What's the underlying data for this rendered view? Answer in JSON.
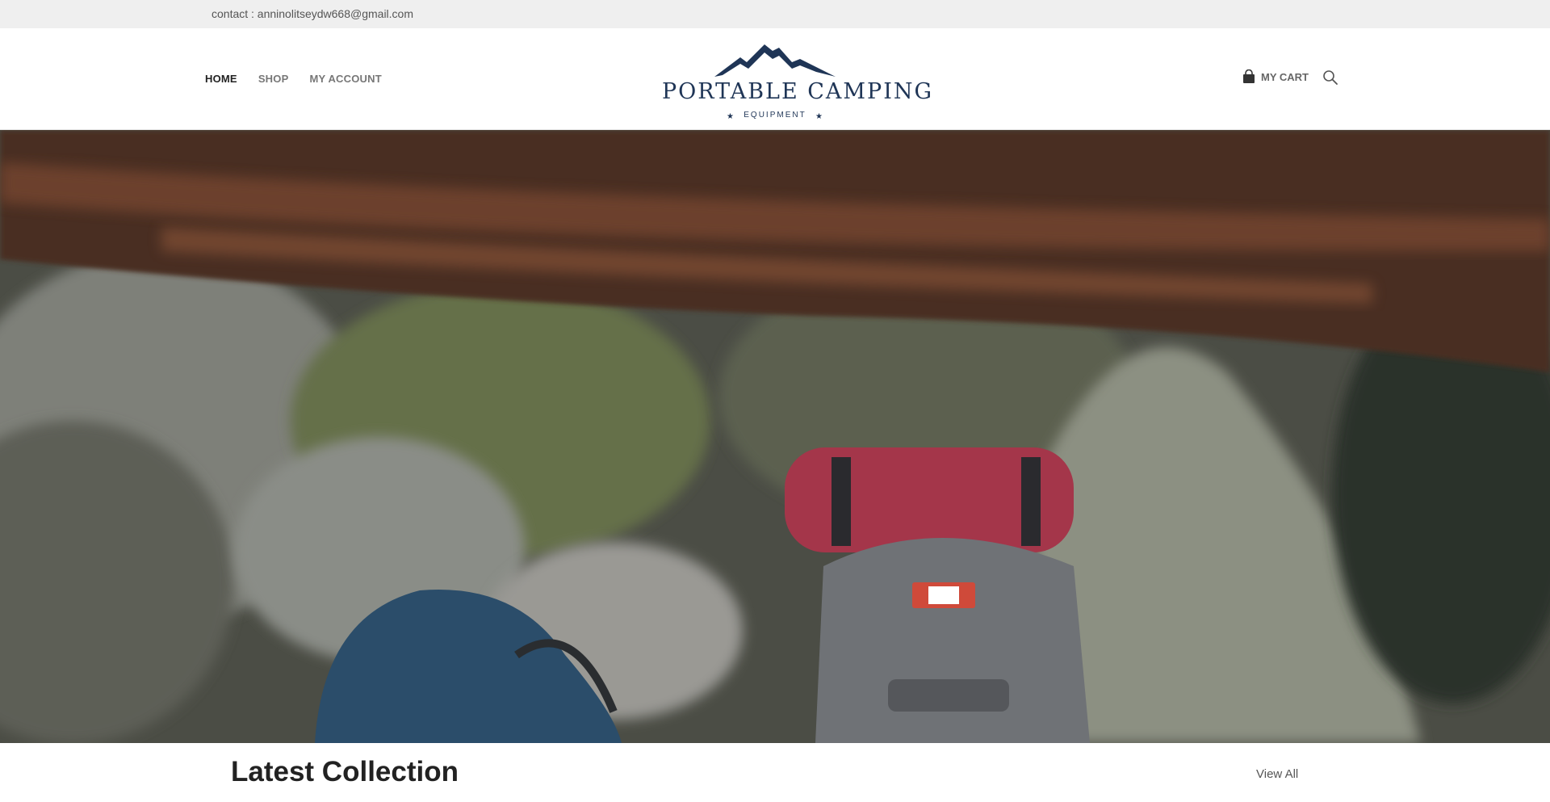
{
  "topbar": {
    "contact": "contact : anninolitseydw668@gmail.com"
  },
  "nav": [
    {
      "label": "HOME"
    },
    {
      "label": "SHOP"
    },
    {
      "label": "MY ACCOUNT"
    }
  ],
  "logo": {
    "brand": "PORTABLE CAMPING",
    "sub": "EQUIPMENT",
    "color": "#1f3556"
  },
  "header_actions": {
    "cart_label": "MY CART",
    "cart_icon": "shopping-bag-icon",
    "search_icon": "search-icon"
  },
  "section": {
    "title": "Latest Collection",
    "view_all": "View All"
  }
}
